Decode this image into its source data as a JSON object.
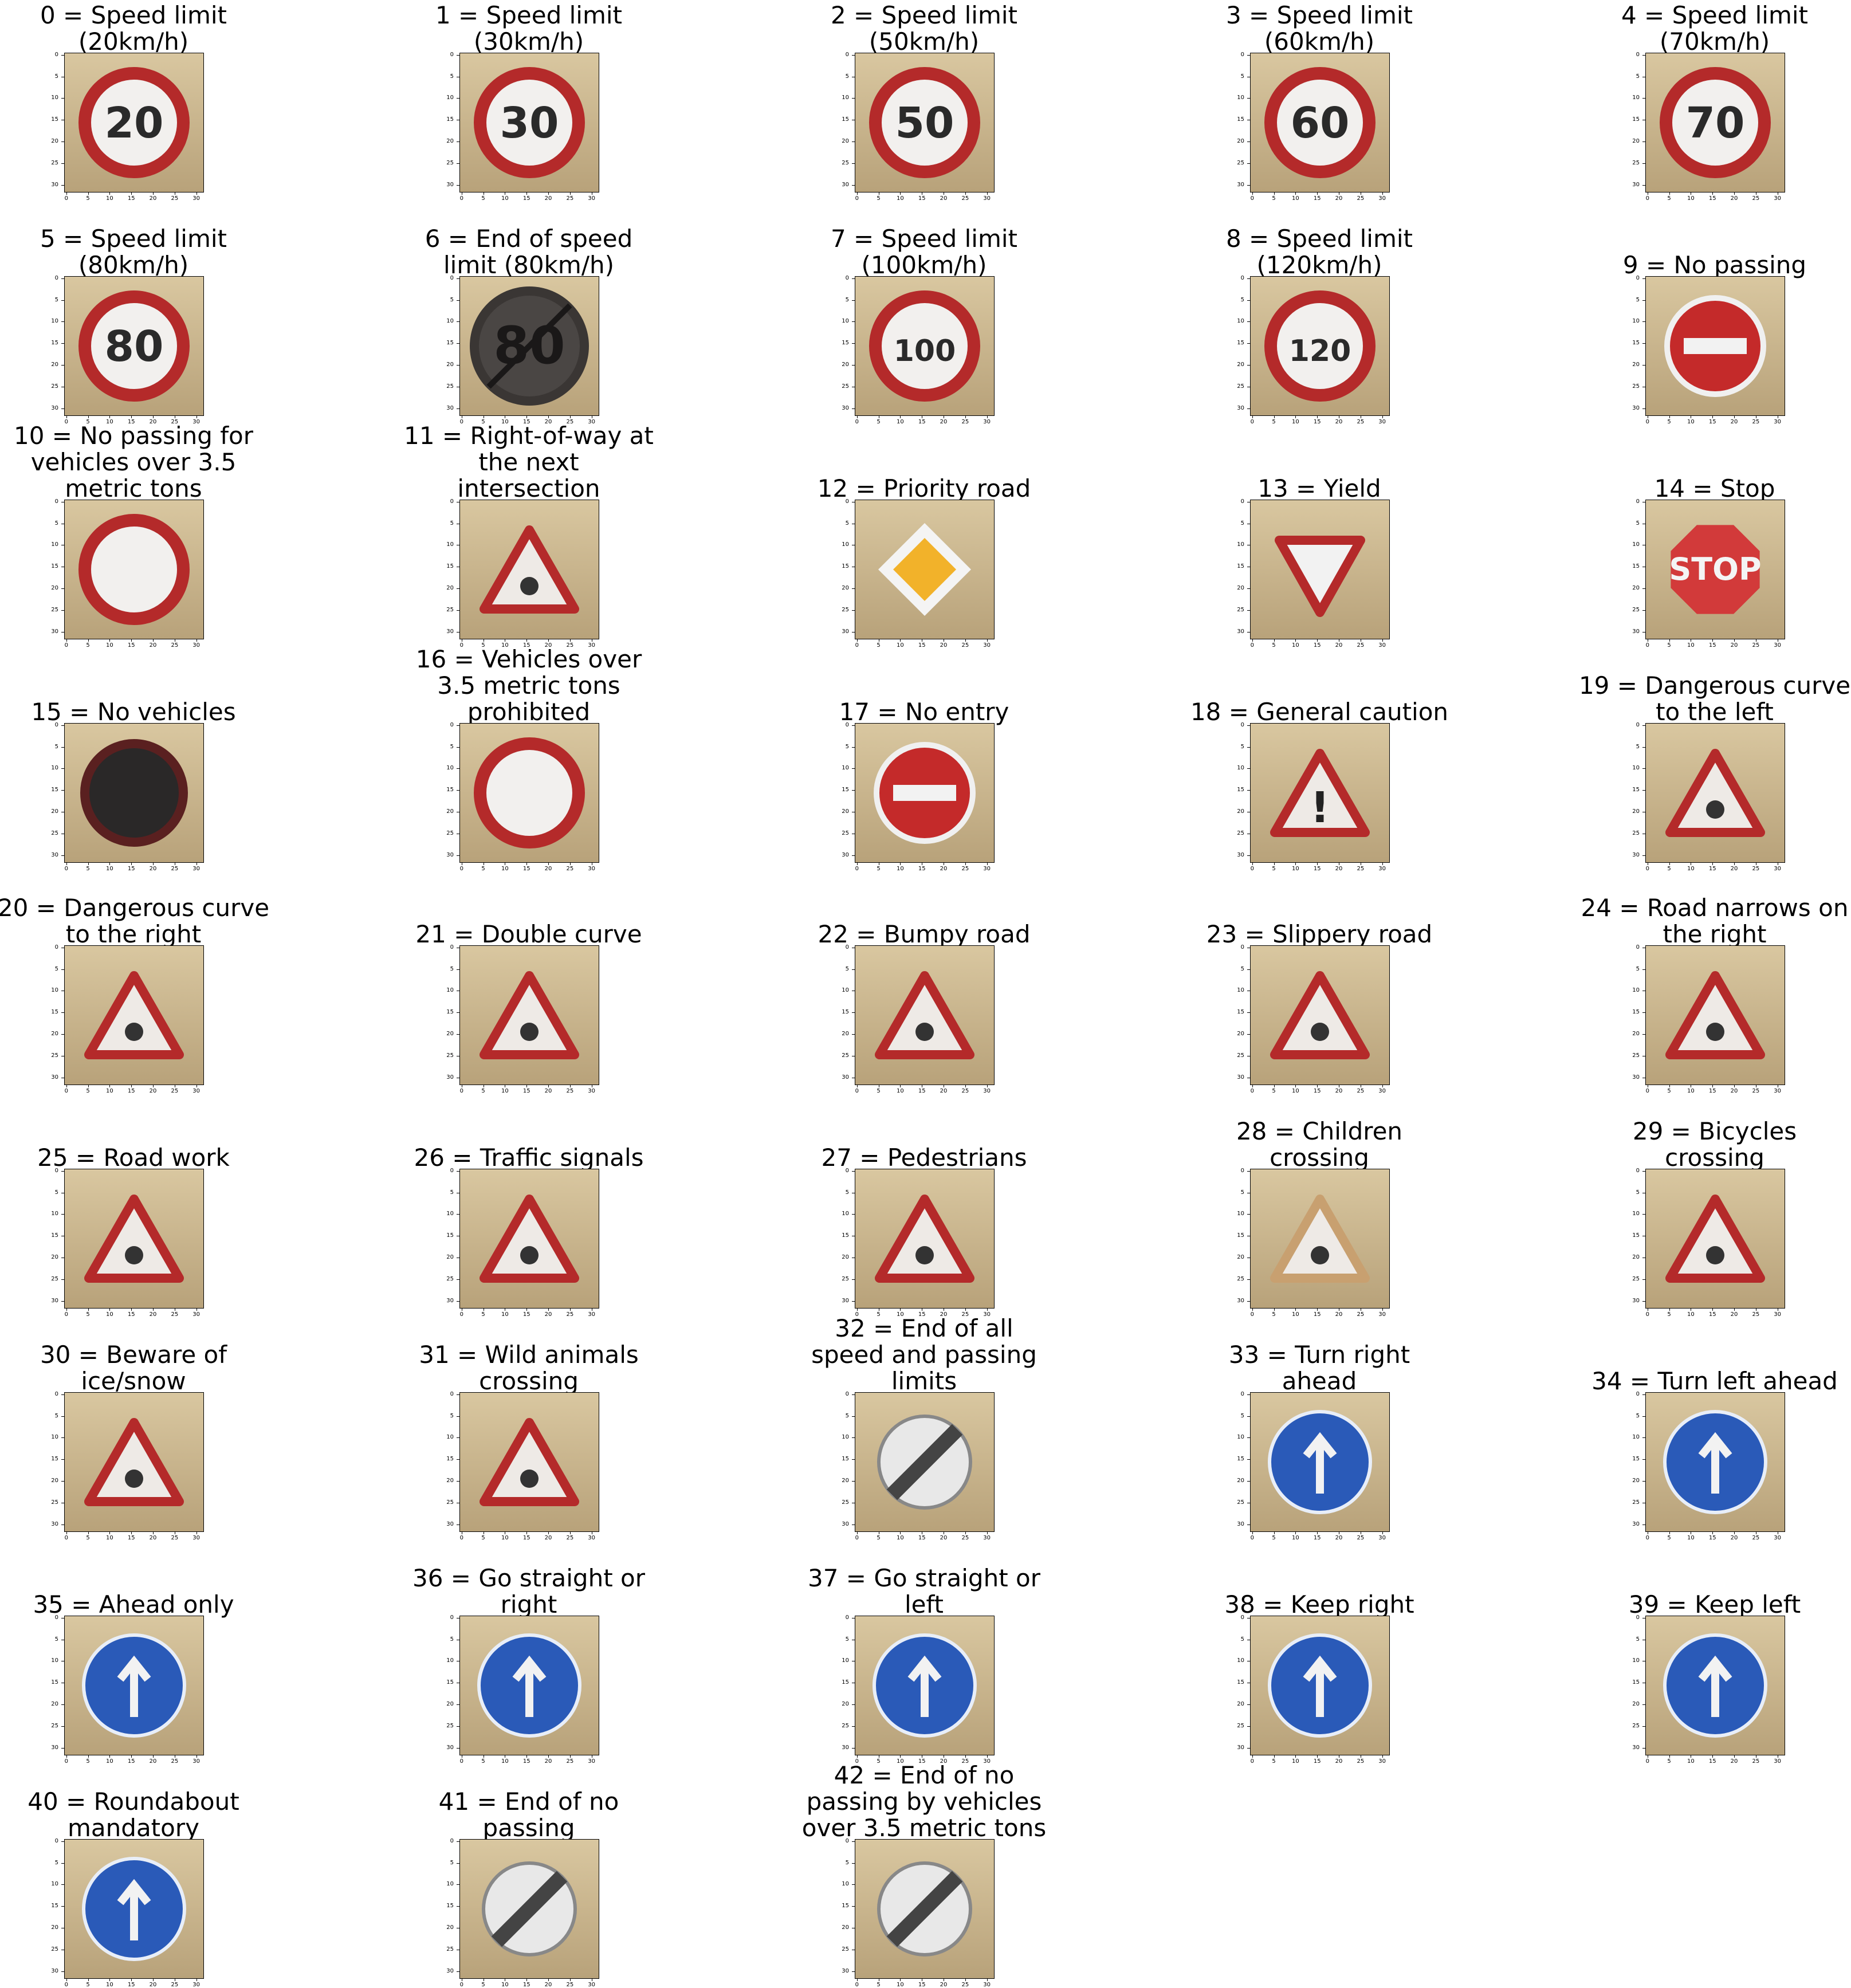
{
  "figure": {
    "x_ticks": [
      "0",
      "5",
      "10",
      "15",
      "20",
      "25",
      "30"
    ],
    "y_ticks": [
      "0",
      "5",
      "10",
      "15",
      "20",
      "25",
      "30"
    ],
    "panels": [
      {
        "title": "0 = Speed limit\n(20km/h)",
        "sign": "circle-red",
        "text": "20",
        "bg": "#d9c7a0",
        "bg2": "#b8a27a"
      },
      {
        "title": "1 = Speed limit\n(30km/h)",
        "sign": "circle-red",
        "text": "30",
        "bg": "#6d5a60",
        "bg2": "#4f4250"
      },
      {
        "title": "2 = Speed limit\n(50km/h)",
        "sign": "circle-red",
        "text": "50",
        "bg": "#6b5a35",
        "bg2": "#463a22"
      },
      {
        "title": "3 = Speed limit\n(60km/h)",
        "sign": "circle-red",
        "text": "60",
        "bg": "#2a2628",
        "bg2": "#1a181a"
      },
      {
        "title": "4 = Speed limit\n(70km/h)",
        "sign": "circle-red",
        "text": "70",
        "bg": "#3a3d4a",
        "bg2": "#25262e"
      },
      {
        "title": "5 = Speed limit\n(80km/h)",
        "sign": "circle-red",
        "text": "80",
        "bg": "#7f8ea8",
        "bg2": "#1c1c20"
      },
      {
        "title": "6 = End of speed\nlimit (80km/h)",
        "sign": "end",
        "text": "80",
        "bg": "#e8e8e8",
        "bg2": "#2a2624"
      },
      {
        "title": "7 = Speed limit\n(100km/h)",
        "sign": "circle-red",
        "text": "100",
        "bg": "#8fa0c0",
        "bg2": "#5e6a70"
      },
      {
        "title": "8 = Speed limit\n(120km/h)",
        "sign": "circle-red",
        "text": "120",
        "bg": "#4c4a58",
        "bg2": "#2a2830"
      },
      {
        "title": "9 = No passing",
        "sign": "no-entry",
        "text": "",
        "bg": "#6a5a3a",
        "bg2": "#3f4a2a"
      },
      {
        "title": "10 = No passing for\nvehicles over 3.5\nmetric tons",
        "sign": "circle-red",
        "text": "",
        "bg": "#4a3a40",
        "bg2": "#2e2428"
      },
      {
        "title": "11 = Right-of-way at\nthe next\nintersection",
        "sign": "triangle",
        "text": "",
        "bg": "#5a3d30",
        "bg2": "#3a2a24"
      },
      {
        "title": "12 = Priority road",
        "sign": "diamond",
        "text": "",
        "bg": "#2a2a34",
        "bg2": "#1a1a22"
      },
      {
        "title": "13 = Yield",
        "sign": "yield",
        "text": "",
        "bg": "#6a7ea8",
        "bg2": "#2a2628"
      },
      {
        "title": "14 = Stop",
        "sign": "stop",
        "text": "STOP",
        "bg": "#f4f4f4",
        "bg2": "#e0e0e8"
      },
      {
        "title": "15 = No vehicles",
        "sign": "circle-dark",
        "text": "",
        "bg": "#8a9ac0",
        "bg2": "#1a1c28"
      },
      {
        "title": "16 = Vehicles over\n3.5 metric tons\nprohibited",
        "sign": "circle-red",
        "text": "",
        "bg": "#c8c4c8",
        "bg2": "#f0f0f0"
      },
      {
        "title": "17 = No entry",
        "sign": "no-entry",
        "text": "",
        "bg": "#3a4a6a",
        "bg2": "#1c2434"
      },
      {
        "title": "18 = General caution",
        "sign": "triangle",
        "text": "!",
        "bg": "#3c3c48",
        "bg2": "#24242c"
      },
      {
        "title": "19 = Dangerous curve\nto the left",
        "sign": "triangle",
        "text": "",
        "bg": "#4a4030",
        "bg2": "#24242a"
      },
      {
        "title": "20 = Dangerous curve\nto the right",
        "sign": "triangle",
        "text": "",
        "bg": "#4a3a2c",
        "bg2": "#2a241e"
      },
      {
        "title": "21 = Double curve",
        "sign": "triangle",
        "text": "",
        "bg": "#4a2a22",
        "bg2": "#2a1a18"
      },
      {
        "title": "22 = Bumpy road",
        "sign": "triangle",
        "text": "",
        "bg": "#5a4a3c",
        "bg2": "#3a2e26"
      },
      {
        "title": "23 = Slippery road",
        "sign": "triangle",
        "text": "",
        "bg": "#3a4050",
        "bg2": "#1c1e24"
      },
      {
        "title": "24 = Road narrows on\nthe right",
        "sign": "triangle",
        "text": "",
        "bg": "#5a5040",
        "bg2": "#3a3a3a"
      },
      {
        "title": "25 = Road work",
        "sign": "triangle",
        "text": "",
        "bg": "#3a3c3a",
        "bg2": "#2a2c2a"
      },
      {
        "title": "26 = Traffic signals",
        "sign": "triangle",
        "text": "",
        "bg": "#3a6a9a",
        "bg2": "#1a2a3a"
      },
      {
        "title": "27 = Pedestrians",
        "sign": "triangle",
        "text": "",
        "bg": "#5a4a3a",
        "bg2": "#2a2a30"
      },
      {
        "title": "28 = Children\ncrossing",
        "sign": "triangle-tan",
        "text": "",
        "bg": "#fafafa",
        "bg2": "#f0f0f0"
      },
      {
        "title": "29 = Bicycles\ncrossing",
        "sign": "triangle",
        "text": "",
        "bg": "#2a2824",
        "bg2": "#3a3630"
      },
      {
        "title": "30 = Beware of\nice/snow",
        "sign": "triangle",
        "text": "",
        "bg": "#3a3c44",
        "bg2": "#2a2a30"
      },
      {
        "title": "31 = Wild animals\ncrossing",
        "sign": "triangle",
        "text": "",
        "bg": "#6a7a9a",
        "bg2": "#1e1c20"
      },
      {
        "title": "32 = End of all\nspeed and passing\nlimits",
        "sign": "end-all",
        "text": "",
        "bg": "#2a2624",
        "bg2": "#1e1a18"
      },
      {
        "title": "33 = Turn right\nahead",
        "sign": "circle-blue",
        "text": "",
        "bg": "#4a3a34",
        "bg2": "#2a2220"
      },
      {
        "title": "34 = Turn left ahead",
        "sign": "circle-blue",
        "text": "",
        "bg": "#9aaad0",
        "bg2": "#3a3a44"
      },
      {
        "title": "35 = Ahead only",
        "sign": "circle-blue",
        "text": "",
        "bg": "#6a5a4a",
        "bg2": "#4a4030"
      },
      {
        "title": "36 = Go straight or\nright",
        "sign": "circle-blue",
        "text": "",
        "bg": "#5a4a44",
        "bg2": "#3a302a"
      },
      {
        "title": "37 = Go straight or\nleft",
        "sign": "circle-blue",
        "text": "",
        "bg": "#4a4038",
        "bg2": "#2a2420"
      },
      {
        "title": "38 = Keep right",
        "sign": "circle-blue",
        "text": "",
        "bg": "#7a5a30",
        "bg2": "#c08040"
      },
      {
        "title": "39 = Keep left",
        "sign": "circle-blue",
        "text": "",
        "bg": "#3a3a30",
        "bg2": "#2a2a24"
      },
      {
        "title": "40 = Roundabout\nmandatory",
        "sign": "circle-blue",
        "text": "",
        "bg": "#5a3a2a",
        "bg2": "#3a2a20"
      },
      {
        "title": "41 = End of no\npassing",
        "sign": "end-light",
        "text": "",
        "bg": "#d8ccb8",
        "bg2": "#a89880"
      },
      {
        "title": "42 = End of no\npassing by vehicles\nover 3.5 metric tons",
        "sign": "end-all",
        "text": "",
        "bg": "#3a3430",
        "bg2": "#c07020"
      }
    ]
  }
}
